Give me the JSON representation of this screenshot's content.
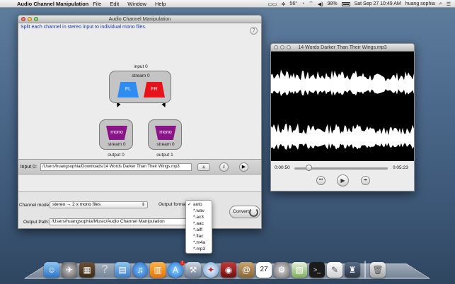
{
  "menubar": {
    "app_name": "Audio Channel Manipulation",
    "menus": [
      "File",
      "Edit",
      "Window",
      "Help"
    ],
    "temperature": "56°",
    "battery": "98%",
    "clock": "Sat Sep 27  10:49 AM",
    "user": "huang sophia"
  },
  "main": {
    "title": "Audio Channel Manipulation",
    "subtitle": "Split each channel in stereo input to individual mono files.",
    "help": "?",
    "graph": {
      "input_label": "input 0",
      "input_stream": "stream 0",
      "channels": [
        "FL",
        "FR"
      ],
      "outputs": [
        {
          "node": "mono",
          "stream": "stream 0",
          "label": "output 0"
        },
        {
          "node": "mono",
          "stream": "stream 0",
          "label": "output 1"
        }
      ]
    },
    "input_row": {
      "label": "input 0:",
      "path": "/Users/huangsophia/Downloads/14 Words Darker Than Their Wings.mp3",
      "add": "+",
      "info": "i",
      "play": "▶"
    },
    "channel_mode_label": "Channel mode:",
    "channel_mode_value": "stereo → 2 x mono files",
    "output_format_label": "Output format",
    "output_path_label": "Output Path:",
    "output_path_value": "/Users/huangsophia/Music/Audio Channel Manipulation",
    "convert_label": "Convert"
  },
  "format_menu": {
    "selected": "auto",
    "options": [
      "auto",
      "*.wav",
      "*.ac3",
      "*.aac",
      "*.aiff",
      "*.flac",
      "*.m4a",
      "*.mp3"
    ]
  },
  "player": {
    "title": "14 Words Darker Than Their Wings.mp3",
    "elapsed": "0:00:50",
    "duration": "0:05:23",
    "progress": 0.155
  },
  "dock": {
    "icons": [
      "finder-icon",
      "launchpad-icon",
      "photo-icon",
      "help-icon",
      "folder-icon",
      "itunes-icon",
      "ibooks-icon",
      "appstore-icon",
      "xcode-icon",
      "safari-icon",
      "photo-booth-icon",
      "contacts-icon",
      "calendar-icon",
      "system-prefs-icon",
      "preview-icon",
      "terminal-icon",
      "textedit-icon",
      "automator-icon",
      "trash-icon"
    ],
    "calendar_day": "27",
    "appstore_badge": "1"
  }
}
